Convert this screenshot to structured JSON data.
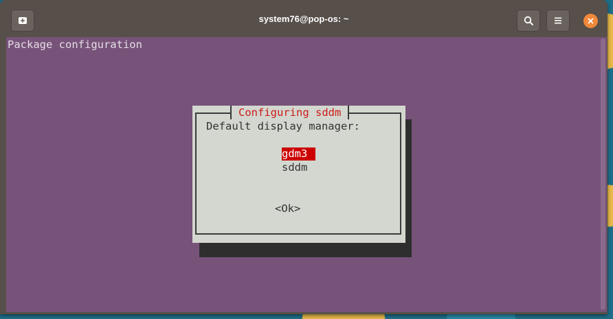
{
  "window": {
    "title": "system76@pop-os: ~"
  },
  "icons": {
    "new_tab": "new-tab-icon",
    "search": "search-icon",
    "menu": "hamburger-menu-icon",
    "close": "close-icon"
  },
  "colors": {
    "terminal_bg": "#775379",
    "dialog_bg": "#d3d7cf",
    "dialog_title": "#cc1a1a",
    "selection_bg": "#cc0000",
    "close_button": "#f0883a"
  },
  "terminal": {
    "header": "Package configuration"
  },
  "dialog": {
    "title": "Configuring sddm",
    "prompt": "Default display manager:",
    "options": [
      {
        "label": "gdm3",
        "selected": true
      },
      {
        "label": "sddm",
        "selected": false
      }
    ],
    "ok_label": "<Ok>"
  }
}
